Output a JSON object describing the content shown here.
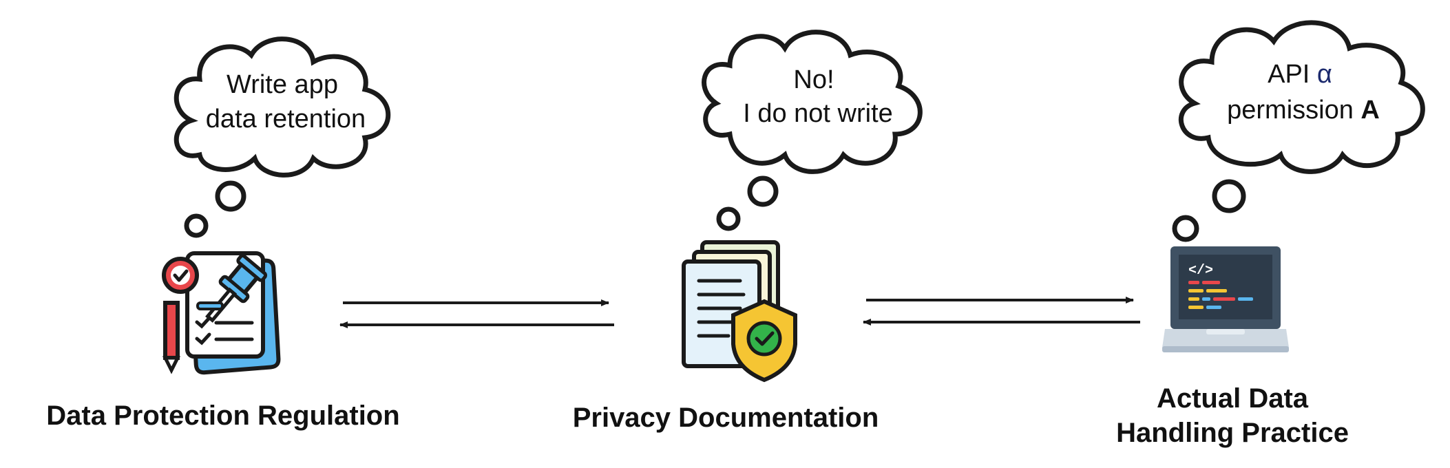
{
  "nodes": {
    "regulation": {
      "label": "Data Protection Regulation",
      "thought": [
        "Write app",
        "data retention"
      ],
      "icon": "legal-document-gavel-icon"
    },
    "documentation": {
      "label": "Privacy Documentation",
      "thought": [
        "No!",
        "I do not write"
      ],
      "icon": "privacy-shield-document-icon"
    },
    "practice": {
      "label_lines": [
        "Actual Data",
        "Handling Practice"
      ],
      "thought_line1_plain": "API ",
      "thought_line1_greek": "α",
      "thought_line2_plain": "permission ",
      "thought_line2_bold": "A",
      "icon": "laptop-code-icon"
    }
  },
  "colors": {
    "stroke": "#1a1a1a",
    "red": "#e8474b",
    "blue": "#5ab6ee",
    "yellow": "#f5c533",
    "green": "#33b34a",
    "screen": "#2d3b4a",
    "paper": "#ffffff",
    "paper_tint": "#e4f2fa"
  }
}
